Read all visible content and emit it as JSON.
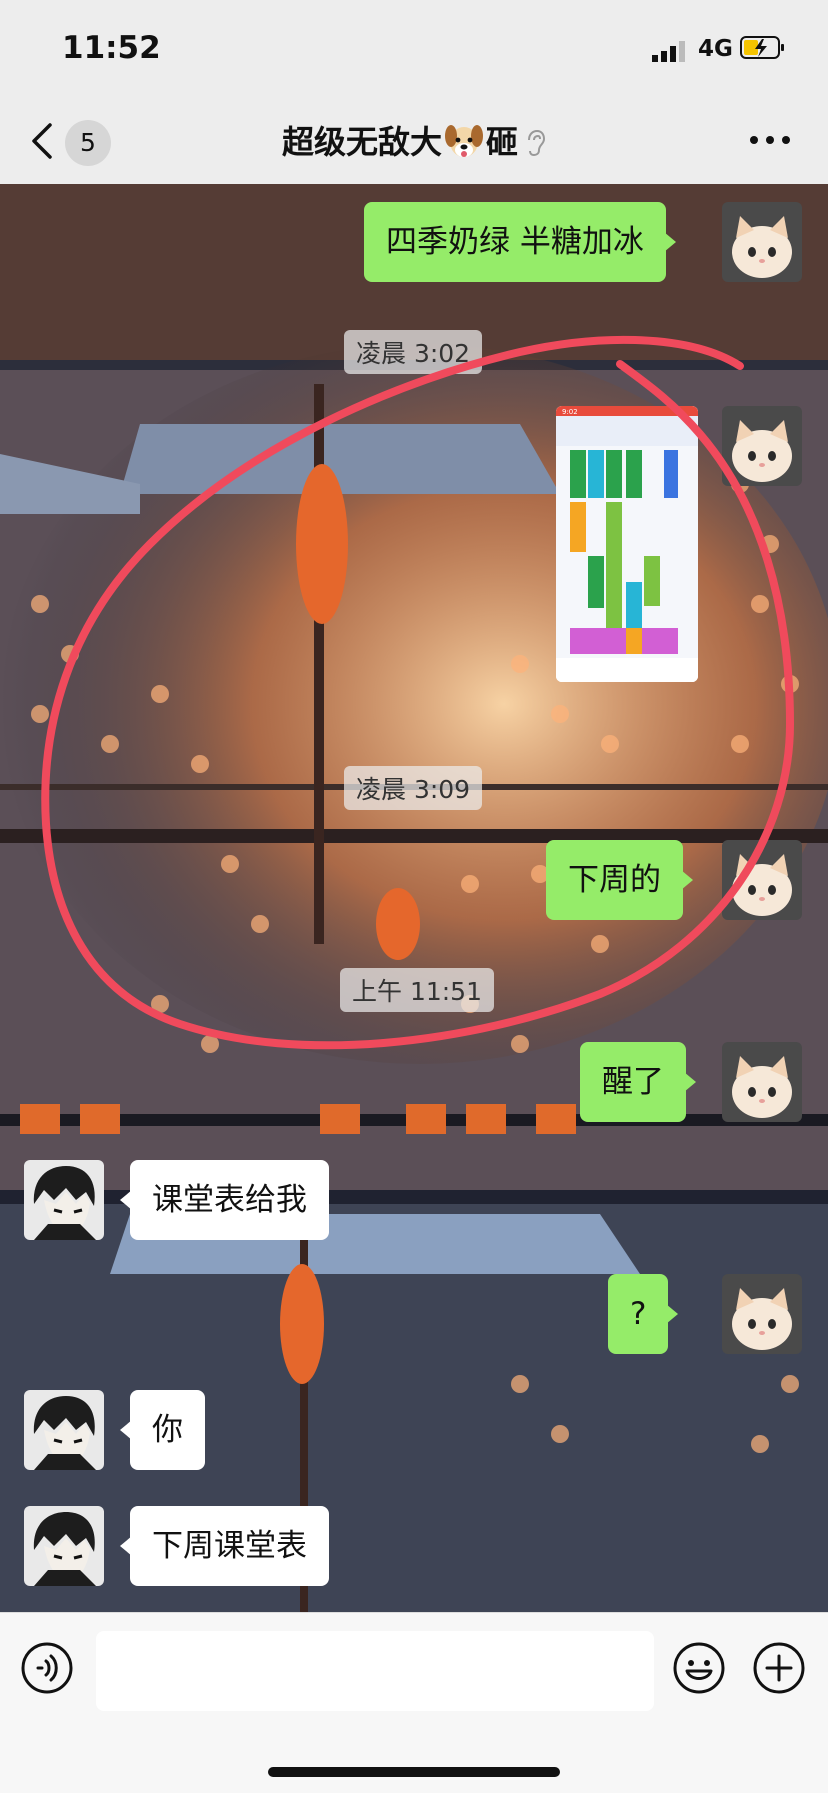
{
  "status": {
    "time": "11:52",
    "network": "4G"
  },
  "header": {
    "unread_count": "5",
    "title_left": "超级无敌大",
    "title_right": "砸"
  },
  "messages": [
    {
      "side": "me",
      "text": "四季奶绿 半糖加冰"
    },
    {
      "side": "time",
      "text": "凌晨 3:02"
    },
    {
      "side": "me",
      "type": "image",
      "thumbnail_time": "9:02"
    },
    {
      "side": "time",
      "text": "凌晨 3:09"
    },
    {
      "side": "me",
      "text": "下周的"
    },
    {
      "side": "time",
      "text": "上午 11:51"
    },
    {
      "side": "me",
      "text": "醒了"
    },
    {
      "side": "them",
      "text": "课堂表给我"
    },
    {
      "side": "me",
      "text": "?"
    },
    {
      "side": "them",
      "text": "你"
    },
    {
      "side": "them",
      "text": "下周课堂表"
    }
  ],
  "input": {
    "placeholder": ""
  },
  "colors": {
    "me_bubble": "#95ec69",
    "them_bubble": "#ffffff",
    "annotation": "#f04a5c"
  },
  "icons": [
    "back-chevron-icon",
    "dog-emoji-icon",
    "ear-icon",
    "more-dots-icon",
    "voice-icon",
    "emoji-icon",
    "plus-icon"
  ]
}
